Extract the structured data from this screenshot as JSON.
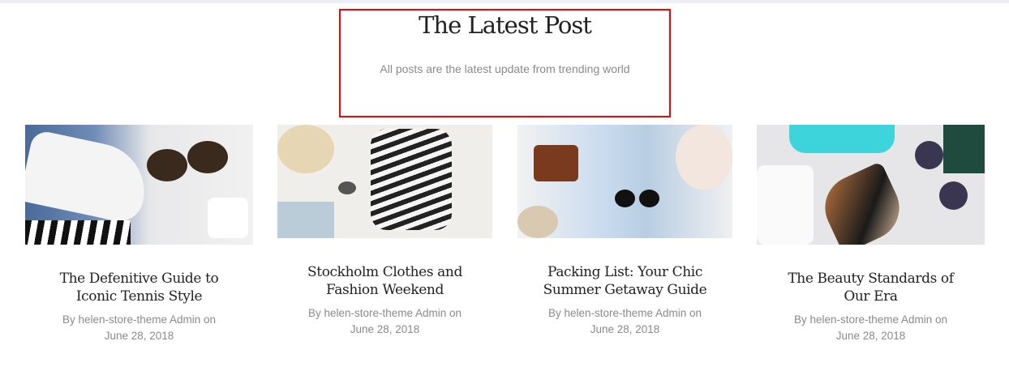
{
  "section": {
    "title": "The Latest Post",
    "subtitle": "All posts are the latest update from trending world"
  },
  "posts": [
    {
      "title": "The Defenitive Guide to Iconic Tennis Style",
      "meta_by": "By helen-store-theme Admin on",
      "date": "June 28, 2018"
    },
    {
      "title": "Stockholm Clothes and Fashion Weekend",
      "meta_by": "By helen-store-theme Admin on",
      "date": "June 28, 2018"
    },
    {
      "title": "Packing List: Your Chic Summer Getaway Guide",
      "meta_by": "By helen-store-theme Admin on",
      "date": "June 28, 2018"
    },
    {
      "title": "The Beauty Standards of Our Era",
      "meta_by": "By helen-store-theme Admin on",
      "date": "June 28, 2018"
    }
  ]
}
